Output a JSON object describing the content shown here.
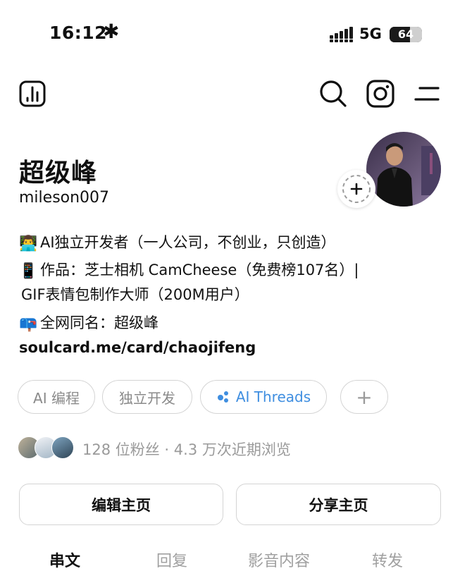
{
  "status_bar": {
    "time": "16:12",
    "extra_glyph": "✱",
    "network": "5G",
    "battery": "64",
    "battery_level": 0.64
  },
  "top_bar": {
    "icons": [
      "insights-icon",
      "search-icon",
      "instagram-icon",
      "menu-icon"
    ]
  },
  "profile": {
    "display_name": "超级峰",
    "username": "mileson007",
    "bio": {
      "line1_emoji": "👨‍💻",
      "line1": "AI独立开发者（一人公司，不创业，只创造）",
      "line2_emoji": "📱",
      "line2": "作品：芝士相机 CamCheese（免费榜107名）|",
      "line3": "GIF表情包制作大师（200M用户）",
      "line4_emoji": "📪",
      "line4": "全网同名：超级峰"
    },
    "link": "soulcard.me/card/chaojifeng"
  },
  "chips": [
    {
      "label": "AI 编程"
    },
    {
      "label": "独立开发"
    },
    {
      "label": "AI Threads"
    },
    {
      "label": "+"
    }
  ],
  "followers": {
    "text": "128 位粉丝 · 4.3 万次近期浏览"
  },
  "buttons": {
    "edit": "编辑主页",
    "share": "分享主页"
  },
  "tabs": [
    {
      "label": "串文",
      "active": true
    },
    {
      "label": "回复",
      "active": false
    },
    {
      "label": "影音内容",
      "active": false
    },
    {
      "label": "转发",
      "active": false
    }
  ],
  "colors": {
    "accent_blue": "#3f8ee0",
    "muted_text": "#9a9a9a",
    "border": "#d4d4d4"
  }
}
